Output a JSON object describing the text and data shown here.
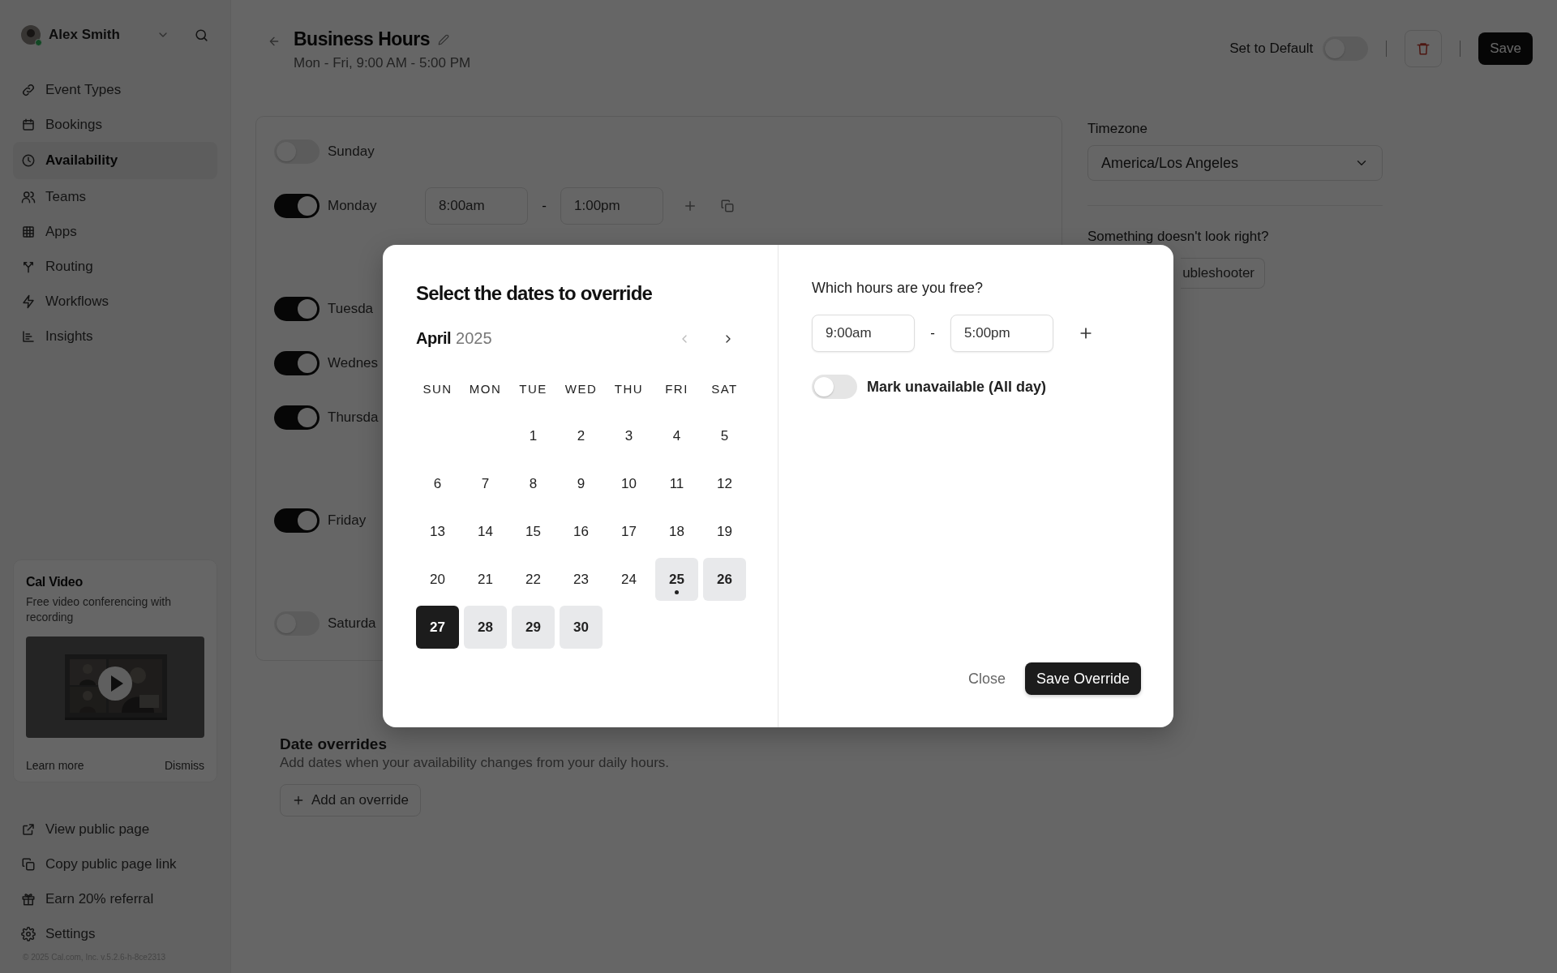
{
  "sidebar": {
    "user": {
      "name": "Alex Smith",
      "online": true
    },
    "nav": [
      {
        "label": "Event Types",
        "selected": false
      },
      {
        "label": "Bookings",
        "selected": false
      },
      {
        "label": "Availability",
        "selected": true
      },
      {
        "label": "Teams",
        "selected": false
      },
      {
        "label": "Apps",
        "selected": false
      },
      {
        "label": "Routing",
        "selected": false
      },
      {
        "label": "Workflows",
        "selected": false
      },
      {
        "label": "Insights",
        "selected": false
      }
    ],
    "promo": {
      "title": "Cal Video",
      "text": "Free video conferencing with recording",
      "actions": [
        "Learn more",
        "Dismiss"
      ]
    },
    "links": [
      "View public page",
      "Copy public page link",
      "Earn 20% referral",
      "Settings"
    ],
    "copyright": "© 2025 Cal.com, Inc. v.5.2.6-h-8ce2313"
  },
  "header": {
    "title": "Business Hours",
    "subtitle": "Mon - Fri, 9:00 AM - 5:00 PM",
    "default_label": "Set to Default",
    "default_on": false,
    "save": "Save"
  },
  "schedule": {
    "days": [
      {
        "name": "Sunday",
        "on": false
      },
      {
        "name": "Monday",
        "on": true,
        "slots": [
          {
            "from": "8:00am",
            "sep": "-",
            "to": "1:00pm"
          }
        ]
      },
      {
        "name": "Tuesda",
        "on": true
      },
      {
        "name": "Wednes",
        "on": true
      },
      {
        "name": "Thursda",
        "on": true
      },
      {
        "name": "Friday",
        "on": true
      },
      {
        "name": "Saturda",
        "on": false
      }
    ]
  },
  "overrides": {
    "title": "Date overrides",
    "text": "Add dates when your availability changes from your daily hours.",
    "button": "Add an override"
  },
  "side": {
    "timezone_label": "Timezone",
    "timezone": "America/Los Angeles",
    "trouble_title": "Something doesn't look right?",
    "trouble_button": "ubleshooter"
  },
  "modal": {
    "title": "Select the dates to override",
    "month": "April",
    "year": "2025",
    "weekdays": [
      "SUN",
      "MON",
      "TUE",
      "WED",
      "THU",
      "FRI",
      "SAT"
    ],
    "days": [
      {
        "kind": "blank"
      },
      {
        "kind": "blank"
      },
      {
        "kind": "day",
        "label": "1",
        "selected": false,
        "today": false,
        "current": false
      },
      {
        "kind": "day",
        "label": "2",
        "selected": false,
        "today": false,
        "current": false
      },
      {
        "kind": "day",
        "label": "3",
        "selected": false,
        "today": false,
        "current": false
      },
      {
        "kind": "day",
        "label": "4",
        "selected": false,
        "today": false,
        "current": false
      },
      {
        "kind": "day",
        "label": "5",
        "selected": false,
        "today": false,
        "current": false
      },
      {
        "kind": "day",
        "label": "6",
        "selected": false,
        "today": false,
        "current": false
      },
      {
        "kind": "day",
        "label": "7",
        "selected": false,
        "today": false,
        "current": false
      },
      {
        "kind": "day",
        "label": "8",
        "selected": false,
        "today": false,
        "current": false
      },
      {
        "kind": "day",
        "label": "9",
        "selected": false,
        "today": false,
        "current": false
      },
      {
        "kind": "day",
        "label": "10",
        "selected": false,
        "today": false,
        "current": false
      },
      {
        "kind": "day",
        "label": "11",
        "selected": false,
        "today": false,
        "current": false
      },
      {
        "kind": "day",
        "label": "12",
        "selected": false,
        "today": false,
        "current": false
      },
      {
        "kind": "day",
        "label": "13",
        "selected": false,
        "today": false,
        "current": false
      },
      {
        "kind": "day",
        "label": "14",
        "selected": false,
        "today": false,
        "current": false
      },
      {
        "kind": "day",
        "label": "15",
        "selected": false,
        "today": false,
        "current": false
      },
      {
        "kind": "day",
        "label": "16",
        "selected": false,
        "today": false,
        "current": false
      },
      {
        "kind": "day",
        "label": "17",
        "selected": false,
        "today": false,
        "current": false
      },
      {
        "kind": "day",
        "label": "18",
        "selected": false,
        "today": false,
        "current": false
      },
      {
        "kind": "day",
        "label": "19",
        "selected": false,
        "today": false,
        "current": false
      },
      {
        "kind": "day",
        "label": "20",
        "selected": false,
        "today": false,
        "current": false
      },
      {
        "kind": "day",
        "label": "21",
        "selected": false,
        "today": false,
        "current": false
      },
      {
        "kind": "day",
        "label": "22",
        "selected": false,
        "today": false,
        "current": false
      },
      {
        "kind": "day",
        "label": "23",
        "selected": false,
        "today": false,
        "current": false
      },
      {
        "kind": "day",
        "label": "24",
        "selected": false,
        "today": false,
        "current": false
      },
      {
        "kind": "day",
        "label": "25",
        "selected": true,
        "today": true,
        "current": false
      },
      {
        "kind": "day",
        "label": "26",
        "selected": true,
        "today": false,
        "current": false
      },
      {
        "kind": "day",
        "label": "27",
        "selected": true,
        "today": false,
        "current": true
      },
      {
        "kind": "day",
        "label": "28",
        "selected": true,
        "today": false,
        "current": false
      },
      {
        "kind": "day",
        "label": "29",
        "selected": true,
        "today": false,
        "current": false
      },
      {
        "kind": "day",
        "label": "30",
        "selected": true,
        "today": false,
        "current": false
      }
    ],
    "hours_title": "Which hours are you free?",
    "from": "9:00am",
    "sep": "-",
    "to": "5:00pm",
    "unavailable": {
      "label": "Mark unavailable (All day)",
      "on": false
    },
    "buttons": [
      {
        "label": "Close",
        "kind": "ghost"
      },
      {
        "label": "Save Override",
        "kind": "primary"
      }
    ]
  }
}
